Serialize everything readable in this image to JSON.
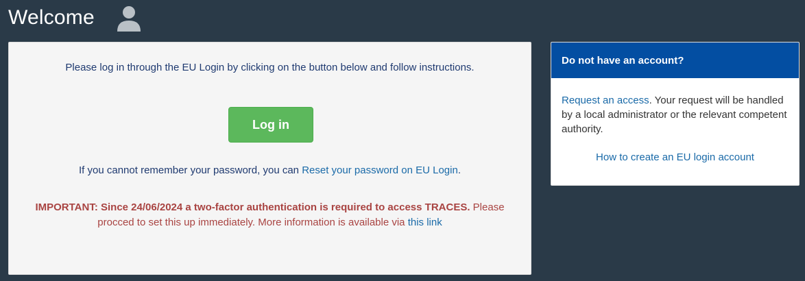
{
  "header": {
    "title": "Welcome",
    "icon": "user-icon"
  },
  "login_panel": {
    "intro_text": "Please log in through the EU Login by clicking on the button below and follow instructions.",
    "login_button_label": "Log in",
    "reset_prefix": "If you cannot remember your password, you can ",
    "reset_link": "Reset your password on EU Login",
    "reset_suffix": ".",
    "important_bold": "IMPORTANT: Since 24/06/2024 a two-factor authentication is required to access TRACES.",
    "important_text": " Please procced to set this up immediately. More information is available via ",
    "important_link": "this link"
  },
  "account_panel": {
    "header": "Do not have an account?",
    "request_link": "Request an access",
    "request_text": ". Your request will be handled by a local administrator or the relevant competent authority.",
    "howto_link": "How to create an EU login account"
  },
  "colors": {
    "background": "#2a3a48",
    "login_button": "#5cb85c",
    "panel_header": "#034ea2",
    "important_text": "#a94442",
    "link": "#1a6aa8"
  }
}
